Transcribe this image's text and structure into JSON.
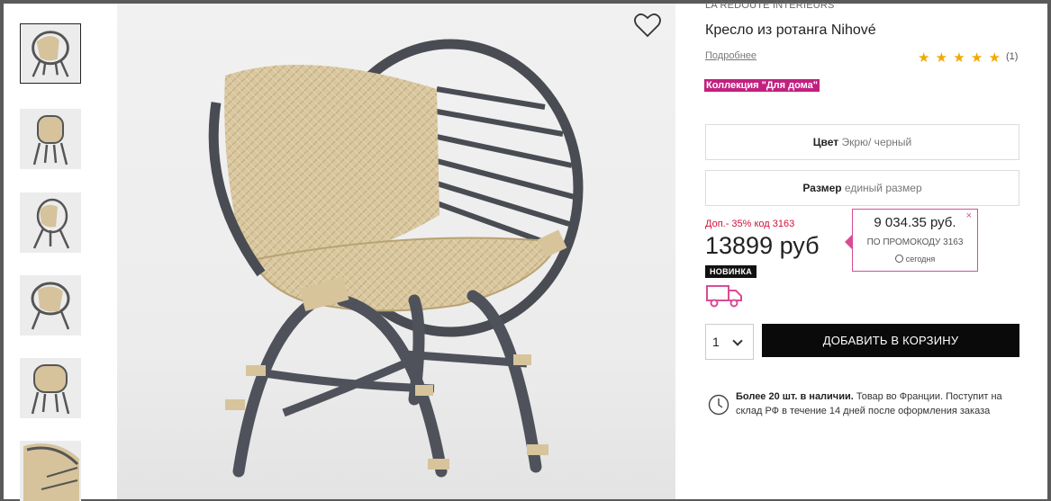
{
  "product": {
    "brand": "LA REDOUTE INTERIEURS",
    "title": "Кресло из ротанга Nihové",
    "more_link": "Подробнее",
    "rating": {
      "stars": 5,
      "count": "(1)"
    },
    "collection": "Коллекция \"Для дома\""
  },
  "options": {
    "color_label": "Цвет",
    "color_value": "Экрю/ черный",
    "size_label": "Размер",
    "size_value": "единый размер"
  },
  "pricing": {
    "promo_note": "Доп.- 35% код 3163",
    "price": "13899 руб",
    "promo_price": "9 034.35 руб.",
    "promo_code_text": "ПО ПРОМОКОДУ 3163",
    "promo_today": "сегодня",
    "close": "×",
    "badge": "НОВИНКА"
  },
  "cart": {
    "quantity": "1",
    "add_button": "ДОБАВИТЬ В КОРЗИНУ"
  },
  "stock": {
    "bold": "Более 20 шт. в наличии.",
    "text": " Товар во Франции. Поступит на склад РФ в течение 14 дней после оформления заказа"
  },
  "colors": {
    "accent_pink": "#c2207f",
    "star": "#f2a900",
    "promo_red": "#d0103a",
    "button_black": "#0a0a0a"
  },
  "icons": [
    "heart-icon",
    "star-icon",
    "close-icon",
    "clock-icon",
    "truck-icon",
    "chevron-down-icon"
  ]
}
